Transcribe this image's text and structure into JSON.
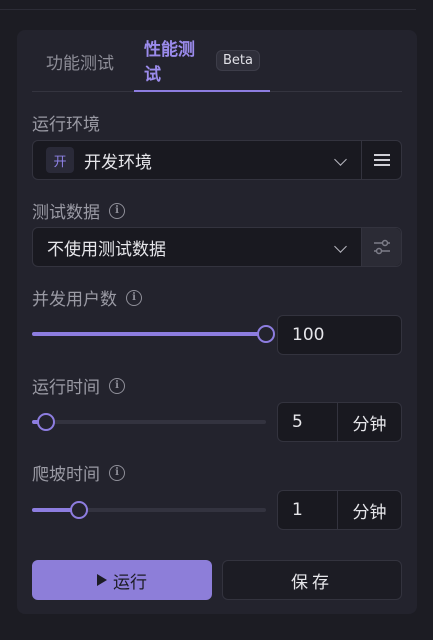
{
  "tabs": [
    {
      "label": "功能测试"
    },
    {
      "label": "性能测试",
      "badge": "Beta"
    }
  ],
  "environment": {
    "label": "运行环境",
    "tag": "开",
    "value": "开发环境",
    "side_icon": "menu-icon"
  },
  "test_data": {
    "label": "测试数据",
    "value": "不使用测试数据",
    "side_icon": "sliders-icon"
  },
  "concurrent_users": {
    "label": "并发用户数",
    "value": "100",
    "slider_fraction": 1.0
  },
  "run_time": {
    "label": "运行时间",
    "value": "5",
    "unit": "分钟",
    "slider_fraction": 0.06
  },
  "ramp_time": {
    "label": "爬坡时间",
    "value": "1",
    "unit": "分钟",
    "slider_fraction": 0.2
  },
  "actions": {
    "run": "运行",
    "save": "保存"
  },
  "colors": {
    "accent": "#8d7de0",
    "background": "#1c1c23",
    "panel": "#23232d"
  }
}
